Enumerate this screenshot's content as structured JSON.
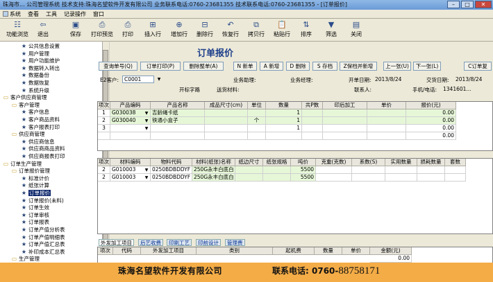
{
  "window": {
    "title": "珠海市... 公司管理系统 技术支持:珠海名望软件开发有限公司 业务联系电话:0760-23681355 技术联系电话:0760-23681355 - [订单报价]"
  },
  "menu": [
    "系统",
    "查看",
    "工具",
    "记录操作",
    "窗口"
  ],
  "toolbar": [
    "功能浏览",
    "退出",
    "保存",
    "打印预览",
    "打印",
    "插入行",
    "增加行",
    "删除行",
    "恢复行",
    "拷贝行",
    "粘贴行",
    "排序",
    "筛选",
    "关闭"
  ],
  "sidebar": [
    {
      "label": "公共信息设置",
      "level": 3
    },
    {
      "label": "用户管理",
      "level": 3
    },
    {
      "label": "用户功能维护",
      "level": 3
    },
    {
      "label": "数据转入转出",
      "level": 3
    },
    {
      "label": "数据备份",
      "level": 3
    },
    {
      "label": "数据恢复",
      "level": 3
    },
    {
      "label": "系统升级",
      "level": 3
    },
    {
      "label": "客户供应商管理",
      "level": 1
    },
    {
      "label": "客户管理",
      "level": 2
    },
    {
      "label": "客户信息",
      "level": 3
    },
    {
      "label": "客户商品资料",
      "level": 3
    },
    {
      "label": "客户报表打印",
      "level": 3
    },
    {
      "label": "供应商管理",
      "level": 2
    },
    {
      "label": "供应商信息",
      "level": 3
    },
    {
      "label": "供应商商品资料",
      "level": 3
    },
    {
      "label": "供应商报表打印",
      "level": 3
    },
    {
      "label": "订单生产管理",
      "level": 1
    },
    {
      "label": "订单报价管理",
      "level": 2
    },
    {
      "label": "标准计价",
      "level": 3
    },
    {
      "label": "纸张计算",
      "level": 3
    },
    {
      "label": "订单报价",
      "level": 3,
      "selected": true
    },
    {
      "label": "订单报价(未料)",
      "level": 3
    },
    {
      "label": "订单生效",
      "level": 3
    },
    {
      "label": "订单审核",
      "level": 3
    },
    {
      "label": "订单报表",
      "level": 3
    },
    {
      "label": "订单产值分析表",
      "level": 3
    },
    {
      "label": "订单产值明细表",
      "level": 3
    },
    {
      "label": "订单产值汇总表",
      "level": 3
    },
    {
      "label": "补印成本汇总表",
      "level": 3
    },
    {
      "label": "生产管理",
      "level": 2
    }
  ],
  "form": {
    "title": "订单报价",
    "buttons": [
      "查询单号(Q)",
      "订单打印(P)",
      "删除整单(A)",
      "N 新单",
      "A 新增",
      "D 删除",
      "S 存档",
      "Z保档并新增",
      "上一张(U)",
      "下一张(L)",
      "C订单复"
    ],
    "customer_label": "E2客户:",
    "customer_value": "C0001",
    "labels": {
      "sales_assistant": "业务助理:",
      "sales_manager": "业务经理:",
      "order_date_label": "开单日期:",
      "order_date": "2013/8/24",
      "delivery_date_label": "交货日期:",
      "delivery_date": "2013/8/24",
      "contact_label": "联系人:",
      "phone_label": "手机/电话:",
      "phone_value": "1341601..."
    },
    "options": [
      "开标字路",
      "送货材料:"
    ]
  },
  "product_grid": {
    "headers": [
      "项次",
      "产品编码",
      "产品名称",
      "成品尺寸(cm)",
      "单位",
      "数量",
      "共P数",
      "印后加工",
      "单价",
      "报价(元)"
    ],
    "rows": [
      {
        "no": "1",
        "code": "G030038",
        "name": "吉龄绳卡纸",
        "size": "",
        "unit": "",
        "qty": "1",
        "p": "",
        "post": "",
        "price": "",
        "quote": "0.00"
      },
      {
        "no": "2",
        "code": "G030040",
        "name": "铁通小盒子",
        "size": "",
        "unit": "个",
        "qty": "1",
        "p": "",
        "post": "",
        "price": "",
        "quote": "0.00"
      },
      {
        "no": "3",
        "code": "",
        "name": "",
        "size": "",
        "unit": "",
        "qty": "1",
        "p": "",
        "post": "",
        "price": "",
        "quote": "0.00"
      },
      {
        "no": "",
        "code": "",
        "name": "",
        "size": "",
        "unit": "",
        "qty": "",
        "p": "",
        "post": "",
        "price": "",
        "quote": "0.00"
      }
    ]
  },
  "material_grid": {
    "headers": [
      "项次",
      "材料编码",
      "物料代码",
      "材料(纸张)名称",
      "纸边尺寸",
      "纸张规格",
      "吨价",
      "克重(克数)",
      "系数(S)",
      "实用数量",
      "损耗数量",
      "套数"
    ],
    "rows": [
      {
        "no": "2",
        "code": "G010003",
        "mat": "0250BDBDDYF",
        "name": "250G永丰白底白",
        "edge": "",
        "spec": "",
        "price": "5500",
        "gsm": "",
        "s": "",
        "qty": "",
        "loss": "",
        "sets": ""
      },
      {
        "no": "2",
        "code": "G010003",
        "mat": "0250BDBDDYF",
        "name": "250G永丰白底白",
        "edge": "",
        "spec": "",
        "price": "5500",
        "gsm": "",
        "s": "",
        "qty": "",
        "loss": "",
        "sets": ""
      }
    ]
  },
  "tabs": [
    "外发加工项目",
    "后艺收费",
    "印刷工艺",
    "印前设计",
    "管理费"
  ],
  "bottom_grid": {
    "headers": [
      "项次",
      "代码",
      "外发加工项目",
      "类别",
      "起机费",
      "数量",
      "单价",
      "金额(元)"
    ],
    "row_value": "0.00"
  },
  "banner": {
    "company": "珠海名望软件开发有限公司",
    "phone_label": "联系电话:",
    "phone_prefix": "0760-",
    "phone_number": "88758171"
  },
  "colors": {
    "accent": "#1d3f8a",
    "banner": "#f4ac46",
    "title_bar": "#6a9bd6",
    "selected": "#0a246a"
  }
}
